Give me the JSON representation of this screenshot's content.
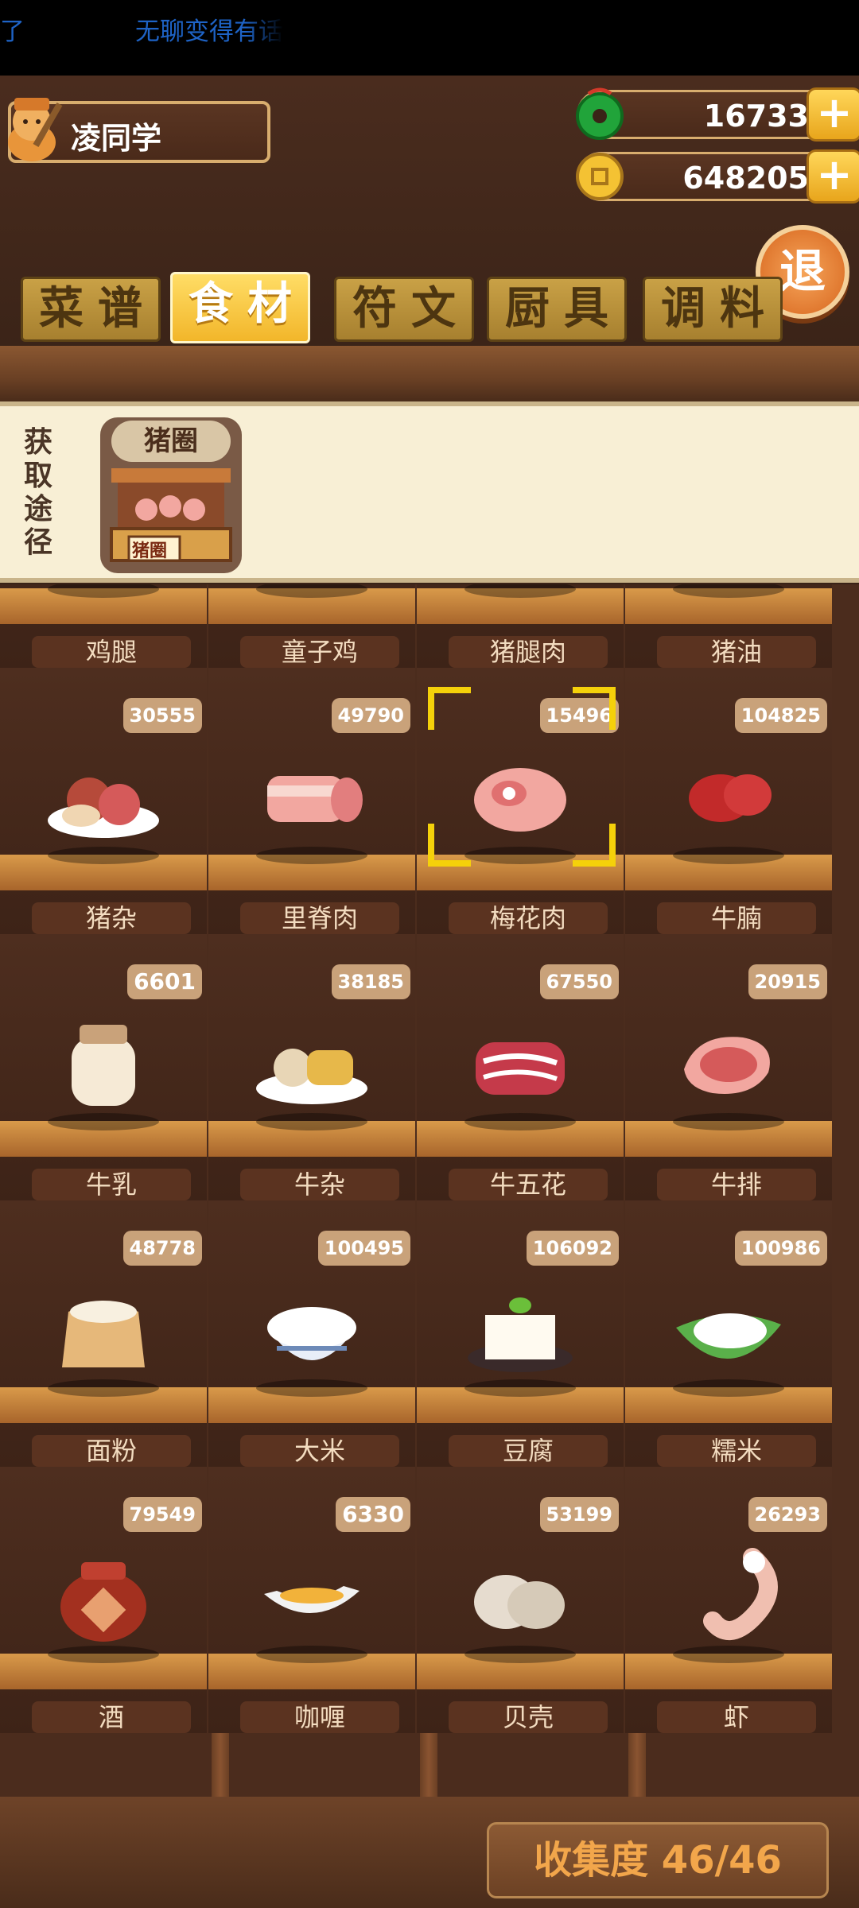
{
  "status": {
    "frag1": "了",
    "frag2": "无聊变得有话"
  },
  "player": {
    "name": "凌同学"
  },
  "currency": {
    "jade": "16733",
    "coins": "648205",
    "plus": "+"
  },
  "exit_label": "退",
  "tabs": [
    "菜谱",
    "食材",
    "符文",
    "厨具",
    "调料"
  ],
  "active_tab": 1,
  "source": {
    "label": "获取途径",
    "card_name": "猪圈",
    "sign": "猪圈"
  },
  "items": [
    {
      "name": "鸡腿",
      "count": null,
      "art": "drumstick"
    },
    {
      "name": "童子鸡",
      "count": null,
      "art": "chicken"
    },
    {
      "name": "猪腿肉",
      "count": null,
      "art": "ham"
    },
    {
      "name": "猪油",
      "count": null,
      "art": "lard"
    },
    {
      "name": "猪杂",
      "count": "30555",
      "art": "offal-plate"
    },
    {
      "name": "里脊肉",
      "count": "49790",
      "art": "tenderloin"
    },
    {
      "name": "梅花肉",
      "count": "15496",
      "art": "pork-steak"
    },
    {
      "name": "牛腩",
      "count": "104825",
      "art": "beef-brisket"
    },
    {
      "name": "牛乳",
      "count": "6601",
      "art": "milk-jar"
    },
    {
      "name": "牛杂",
      "count": "38185",
      "art": "beef-offal"
    },
    {
      "name": "牛五花",
      "count": "67550",
      "art": "beef-belly"
    },
    {
      "name": "牛排",
      "count": "20915",
      "art": "steak"
    },
    {
      "name": "面粉",
      "count": "48778",
      "art": "flour-sack"
    },
    {
      "name": "大米",
      "count": "100495",
      "art": "rice-bowl"
    },
    {
      "name": "豆腐",
      "count": "106092",
      "art": "tofu"
    },
    {
      "name": "糯米",
      "count": "100986",
      "art": "glutinous-rice"
    },
    {
      "name": "酒",
      "count": "79549",
      "art": "wine-jar"
    },
    {
      "name": "咖喱",
      "count": "6330",
      "art": "curry-boat"
    },
    {
      "name": "贝壳",
      "count": "53199",
      "art": "clam"
    },
    {
      "name": "虾",
      "count": "26293",
      "art": "shrimp"
    }
  ],
  "selected_item": "梅花肉",
  "collection": {
    "label": "收集度 46/46"
  },
  "colors": {
    "accent": "#f2b62a",
    "wood": "#6a3f24",
    "select": "#f5d10a"
  }
}
